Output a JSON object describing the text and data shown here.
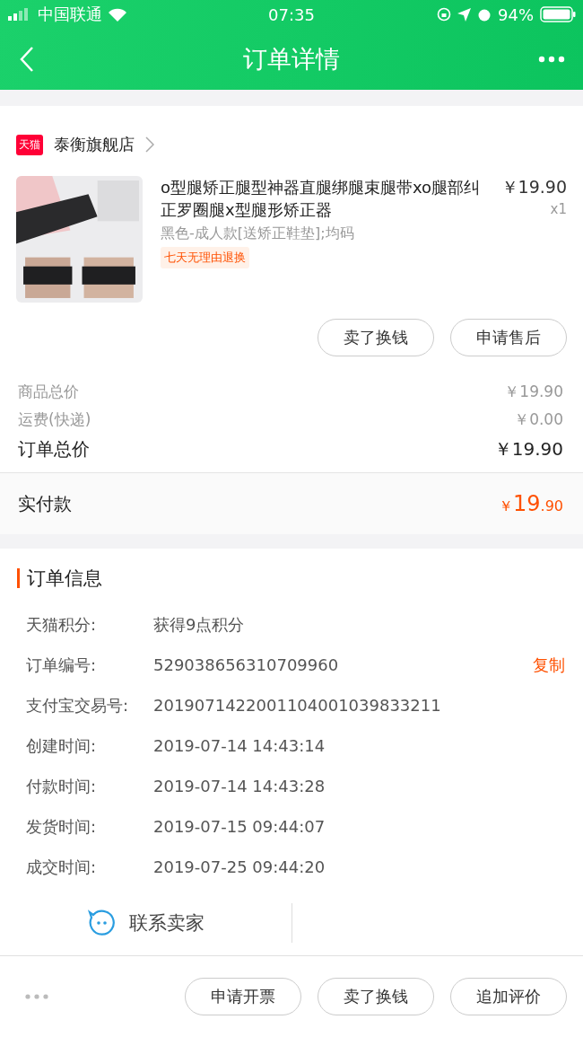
{
  "status_bar": {
    "carrier": "中国联通",
    "time": "07:35",
    "battery": "94%"
  },
  "nav": {
    "title": "订单详情"
  },
  "shop": {
    "badge": "天猫",
    "name": "泰衡旗舰店"
  },
  "product": {
    "kind": "picture",
    "title": "o型腿矫正腿型神器直腿绑腿束腿带xo腿部纠正罗圈腿x型腿形矫正器",
    "price": "￥19.90",
    "quantity": "x1",
    "sku": "黑色-成人款[送矫正鞋垫];均码",
    "tag": "七天无理由退换"
  },
  "item_buttons": [
    "卖了换钱",
    "申请售后"
  ],
  "totals": [
    {
      "label": "商品总价",
      "value": "￥19.90",
      "kind": "minor"
    },
    {
      "label": "运费(快递)",
      "value": "￥0.00",
      "kind": "minor"
    },
    {
      "label": "订单总价",
      "value": "￥19.90",
      "kind": "major"
    }
  ],
  "paid": {
    "label": "实付款",
    "currency": "￥",
    "integer": "19",
    "decimal": ".90"
  },
  "order_info": {
    "title": "订单信息",
    "rows": [
      {
        "label": "天猫积分:",
        "value": "获得9点积分"
      },
      {
        "label": "订单编号:",
        "value": "529038656310709960",
        "action": "复制"
      },
      {
        "label": "支付宝交易号:",
        "value": "2019071422001104001039833211"
      },
      {
        "label": "创建时间:",
        "value": "2019-07-14 14:43:14"
      },
      {
        "label": "付款时间:",
        "value": "2019-07-14 14:43:28"
      },
      {
        "label": "发货时间:",
        "value": "2019-07-15 09:44:07"
      },
      {
        "label": "成交时间:",
        "value": "2019-07-25 09:44:20"
      }
    ]
  },
  "contact": {
    "label": "联系卖家"
  },
  "bottom_buttons": [
    "申请开票",
    "卖了换钱",
    "追加评价"
  ]
}
